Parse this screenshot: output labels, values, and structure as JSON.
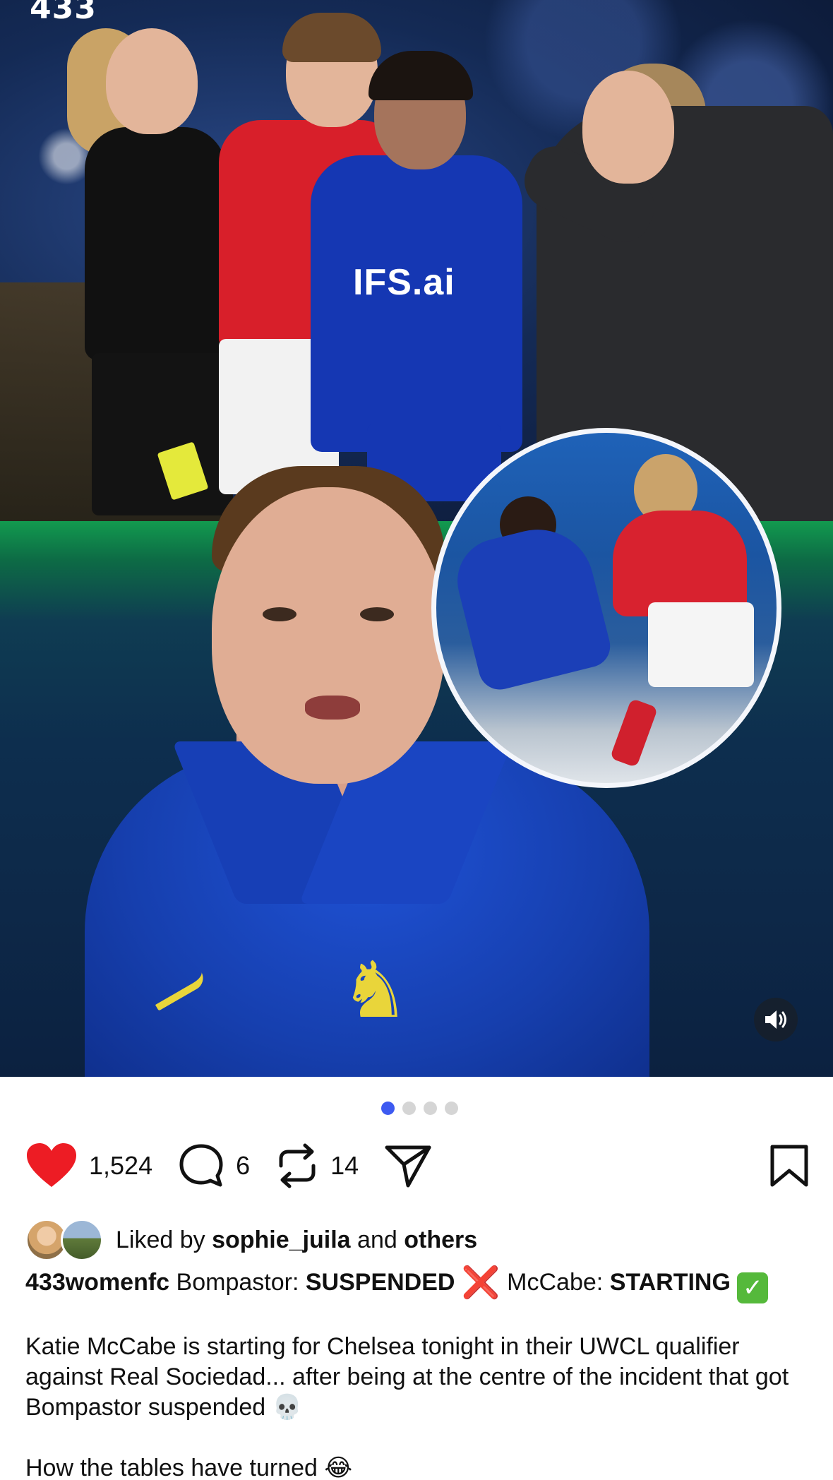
{
  "media": {
    "watermark": "433",
    "top_sponsor": "IFS.ai",
    "current_slide": 1,
    "total_slides": 4
  },
  "actions": {
    "like_count": "1,524",
    "comment_count": "6",
    "repost_count": "14"
  },
  "liked_by": {
    "prefix": "Liked by",
    "user": "sophie_juila",
    "conjunction": "and",
    "others": "others"
  },
  "caption": {
    "username": "433womenfc",
    "headline_part1": "Bompastor:",
    "headline_bold1": "SUSPENDED",
    "headline_emoji1": "❌",
    "headline_part2": "McCabe:",
    "headline_bold2": "STARTING",
    "headline_emoji2": "✅",
    "paragraph1": "Katie McCabe is starting for Chelsea tonight in their UWCL qualifier against Real Sociedad... after being at the centre of the incident that got Bompastor suspended 💀",
    "paragraph2": "How the tables have turned 😂"
  },
  "colors": {
    "like_red": "#ed1c24",
    "dot_active": "#3d5af1",
    "dot_inactive": "#d5d5d5"
  },
  "icons": [
    "heart-icon",
    "comment-icon",
    "repost-icon",
    "share-icon",
    "bookmark-icon",
    "speaker-icon"
  ]
}
